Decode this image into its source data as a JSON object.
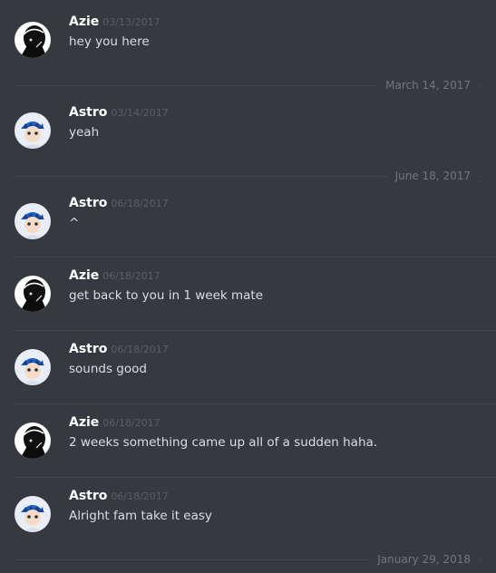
{
  "messages": [
    {
      "author": "Azie",
      "timestamp": "03/13/2017",
      "text": "hey you here",
      "avatar": "azie-avatar"
    },
    {
      "author": "Astro",
      "timestamp": "03/14/2017",
      "text": "yeah",
      "avatar": "astro-avatar"
    },
    {
      "author": "Astro",
      "timestamp": "06/18/2017",
      "text": "^",
      "avatar": "astro-avatar"
    },
    {
      "author": "Azie",
      "timestamp": "06/18/2017",
      "text": "get back to you in 1 week mate",
      "avatar": "azie-avatar"
    },
    {
      "author": "Astro",
      "timestamp": "06/18/2017",
      "text": "sounds good",
      "avatar": "astro-avatar"
    },
    {
      "author": "Azie",
      "timestamp": "06/18/2017",
      "text": "2 weeks something came up all of a sudden haha.",
      "avatar": "azie-avatar"
    },
    {
      "author": "Astro",
      "timestamp": "06/18/2017",
      "text": "Alright fam take it easy",
      "avatar": "astro-avatar"
    }
  ],
  "date_dividers": [
    "March 14, 2017",
    "June 18, 2017",
    "January 29, 2018"
  ],
  "colors": {
    "background": "#36393f",
    "author": "#ffffff",
    "text": "#dcddde",
    "timestamp": "#5b5e64",
    "divider": "#42454a",
    "divider_label": "#72767d"
  }
}
